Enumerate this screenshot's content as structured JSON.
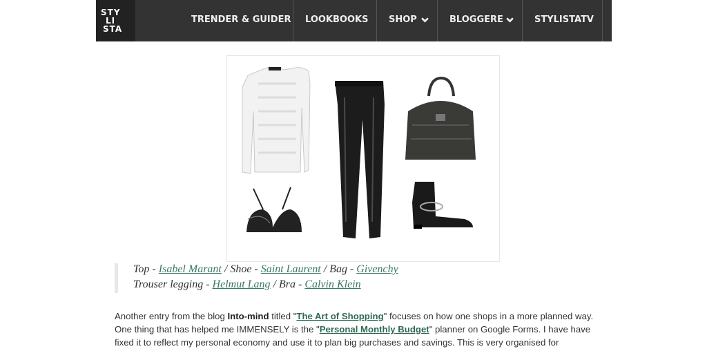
{
  "nav": {
    "logo_lines": [
      "STY",
      "LI",
      "STA"
    ],
    "items": [
      {
        "label": "TRENDER & GUIDER",
        "has_dropdown": false
      },
      {
        "label": "LOOKBOOKS",
        "has_dropdown": false
      },
      {
        "label": "SHOP",
        "has_dropdown": true
      },
      {
        "label": "BLOGGERE",
        "has_dropdown": true
      },
      {
        "label": "STYLISTATV",
        "has_dropdown": false
      }
    ]
  },
  "outfit": {
    "lines": [
      [
        {
          "text": "Top - ",
          "link": false
        },
        {
          "text": "Isabel Marant",
          "link": true
        },
        {
          "text": " / Shoe - ",
          "link": false
        },
        {
          "text": "Saint Laurent",
          "link": true
        },
        {
          "text": " /  Bag - ",
          "link": false
        },
        {
          "text": "Givenchy ",
          "link": true
        }
      ],
      [
        {
          "text": "Trouser legging - ",
          "link": false
        },
        {
          "text": "Helmut Lang",
          "link": true
        },
        {
          "text": " / Bra - ",
          "link": false
        },
        {
          "text": "Calvin Klein",
          "link": true
        }
      ]
    ]
  },
  "article": {
    "p1_a": "Another entry from the blog ",
    "p1_bold": "Into-mind",
    "p1_b": " titled \"",
    "p1_link1": "The Art of Shopping",
    "p1_c": "\" focuses on how one shops in a more planned way. One thing that has helped me IMMENSELY is the \"",
    "p1_link2": "Personal Monthly Budget",
    "p1_d": "\" planner on Google Forms. I have have fixed it to reflect my personal economy and use it to plan big purchases and savings. This is very organised for"
  },
  "colors": {
    "nav_bg": "#333333",
    "logo_bg": "#222222",
    "link": "#3a7a63"
  }
}
